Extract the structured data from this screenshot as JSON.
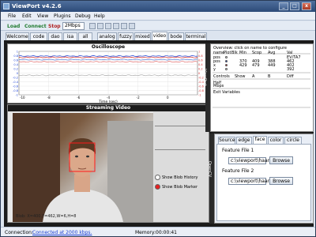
{
  "window": {
    "title": "ViewPort v4.2.6"
  },
  "menu": [
    "File",
    "Edit",
    "View",
    "Plugins",
    "Debug",
    "Help"
  ],
  "toolbar": {
    "load": "Load",
    "connect": "Connect",
    "stop": "Stop",
    "speed": "2Mbps"
  },
  "tabs": [
    "Welcome",
    "code",
    "dao",
    "isa",
    "all",
    "analog",
    "fuzzy",
    "mixed",
    "video",
    "bode",
    "terminal"
  ],
  "tabs_selected": "video",
  "oscilloscope": {
    "title": "Oscilloscope",
    "xlabel": "Time (sec)",
    "left_ticks": [
      "1",
      "0.8",
      "0.6",
      "0.4",
      "0.2",
      "0",
      "-0.2",
      "-0.4",
      "-0.6",
      "-0.8",
      "-1"
    ],
    "right_ticks": [
      "1",
      "0.8",
      "0.6",
      "0.4",
      "0.2",
      "0",
      "-0.2",
      "-0.4",
      "-0.6",
      "-0.8",
      "-1"
    ],
    "x_ticks": [
      "-8",
      "-6",
      "-4",
      "-2",
      "0"
    ],
    "x_edge_left": "-10",
    "series_colors": [
      "#1a3fd6",
      "#d42a2a",
      "#5a7fd8",
      "#e36b6b",
      "#a9a9a9"
    ]
  },
  "video": {
    "title": "Streaming Video",
    "blob_text": "Blob: X=400,Y=462,W=6,H=8",
    "show_blob_history": "Show Blob History",
    "show_blob_marker": "Show Blob Marker"
  },
  "right_panel": {
    "hdr": "Overview: click on name to configure",
    "columns": [
      "name",
      "Plot",
      "Blk",
      "Min",
      "Scop",
      "Avg",
      "Val"
    ],
    "rows": [
      [
        "pos",
        "",
        "",
        "",
        "",
        "",
        "EV/TA7"
      ],
      [
        "pos",
        "",
        "",
        "370",
        "409",
        "388",
        "462"
      ],
      [
        "x",
        "",
        "",
        "429",
        "479",
        "449",
        "402"
      ],
      [
        "y",
        "",
        "",
        "",
        "",
        "",
        "392"
      ]
    ],
    "controls_hdr": [
      "Controls",
      "Show",
      "A",
      "B",
      "Diff"
    ],
    "controls_rows": [
      "Half",
      "Mbps"
    ],
    "exit_text": "Exit Variables",
    "side_label": "ViewPort"
  },
  "bottom_panel": {
    "tabs": [
      "Source",
      "edge",
      "face",
      "color",
      "circle"
    ],
    "selected_tab": "face",
    "feature1_label": "Feature File 1",
    "feature1_value": "c:\\viewport\\haarcascade",
    "feature2_label": "Feature File 2",
    "feature2_value": "c:\\viewport\\haarcascade",
    "browse": "Browse",
    "side_label": "OpenCV"
  },
  "statusbar": {
    "connection_label": "Connection:",
    "connection_value": "Connected at 2000 kbps.",
    "memory_label": "Memory:",
    "memory_value": "00:00:41"
  }
}
